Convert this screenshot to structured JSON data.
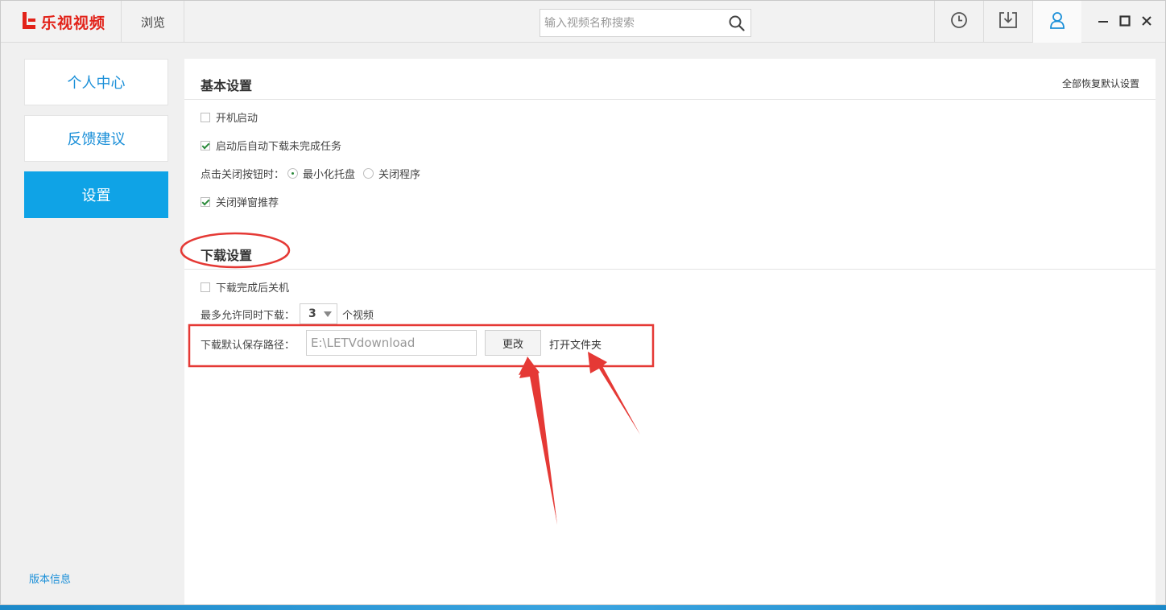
{
  "header": {
    "logo_text": "乐视视频",
    "tab_browse": "浏览",
    "search_placeholder": "输入视频名称搜索",
    "brand_color": "#e2231a",
    "accent_color": "#1a8fd8",
    "icons": [
      "history-icon",
      "download-icon",
      "user-icon",
      "minimize-icon",
      "maximize-icon",
      "close-icon"
    ]
  },
  "sidebar": {
    "items": [
      {
        "label": "个人中心",
        "active": false
      },
      {
        "label": "反馈建议",
        "active": false
      },
      {
        "label": "设置",
        "active": true
      }
    ],
    "version_label": "版本信息"
  },
  "basic": {
    "title": "基本设置",
    "reset_all": "全部恢复默认设置",
    "autostart": {
      "label": "开机启动",
      "checked": false
    },
    "auto_resume": {
      "label": "启动后自动下载未完成任务",
      "checked": true
    },
    "close_action": {
      "label": "点击关闭按钮时：",
      "options": [
        {
          "label": "最小化托盘",
          "selected": true
        },
        {
          "label": "关闭程序",
          "selected": false
        }
      ]
    },
    "close_popup": {
      "label": "关闭弹窗推荐",
      "checked": true
    }
  },
  "download": {
    "title": "下载设置",
    "shutdown_after": {
      "label": "下载完成后关机",
      "checked": false
    },
    "max_parallel_label": "最多允许同时下载：",
    "max_parallel_value": "3",
    "max_parallel_unit": "个视频",
    "path_label": "下载默认保存路径：",
    "path_value": "E:\\LETVdownload",
    "change_button": "更改",
    "open_folder": "打开文件夹"
  }
}
